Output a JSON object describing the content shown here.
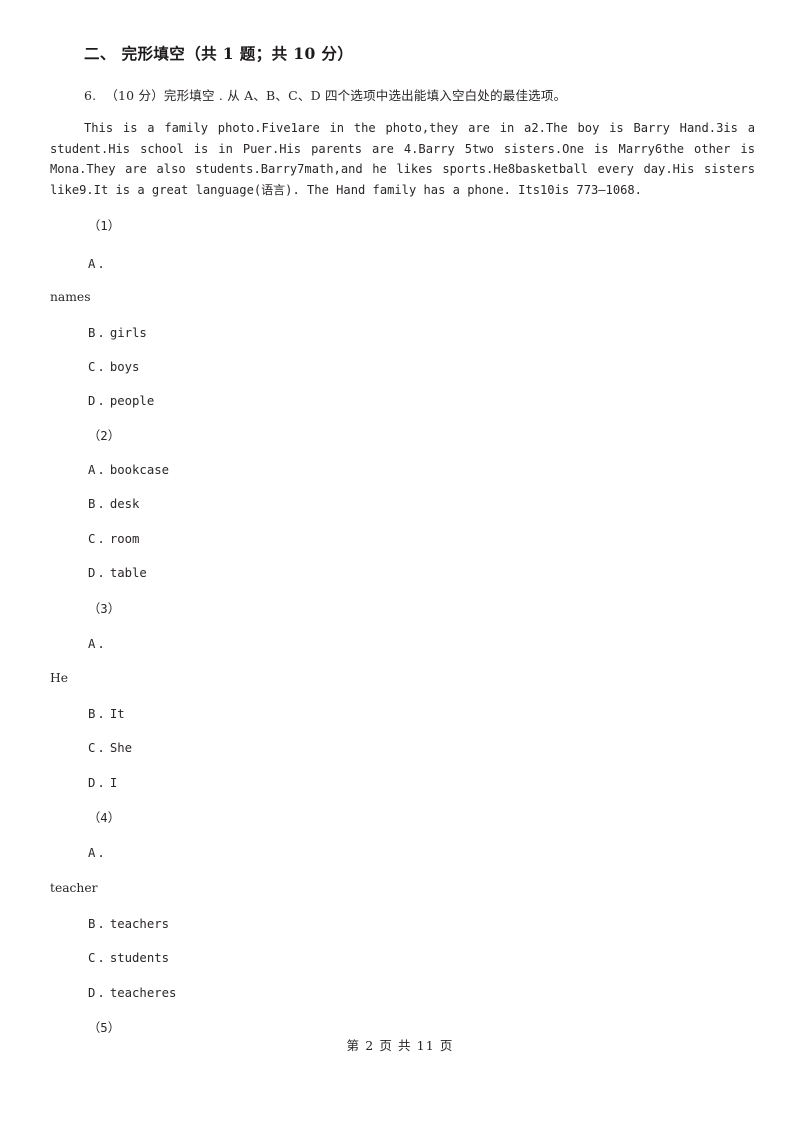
{
  "section": {
    "title": "二、 完形填空（共 1 题；共 10 分）"
  },
  "question": {
    "number": "6.",
    "stem": "（10 分）完形填空 . 从 A、B、C、D 四个选项中选出能填入空白处的最佳选项。",
    "passage": "This is a family photo.Five1are in the photo,they are in a2.The boy is Barry Hand.3is a student.His school is in Puer.His parents are 4.Barry 5two sisters.One is Marry6the other is Mona.They are also students.Barry7math,and he likes sports.He8basketball every day.His sisters like9.It is a great language(",
    "passage_cn": "语言",
    "passage_tail": "). The Hand family has a phone. Its10is 773—1068."
  },
  "options": [
    {
      "index": "（1）",
      "choices": [
        {
          "letter": "A",
          "text": "",
          "orphan_text": "names"
        },
        {
          "letter": "B",
          "text": "girls"
        },
        {
          "letter": "C",
          "text": "boys"
        },
        {
          "letter": "D",
          "text": "people"
        }
      ]
    },
    {
      "index": "（2）",
      "choices": [
        {
          "letter": "A",
          "text": "bookcase"
        },
        {
          "letter": "B",
          "text": "desk"
        },
        {
          "letter": "C",
          "text": "room"
        },
        {
          "letter": "D",
          "text": "table"
        }
      ]
    },
    {
      "index": "（3）",
      "choices": [
        {
          "letter": "A",
          "text": "",
          "orphan_text": "He"
        },
        {
          "letter": "B",
          "text": "It"
        },
        {
          "letter": "C",
          "text": "She"
        },
        {
          "letter": "D",
          "text": "I"
        }
      ]
    },
    {
      "index": "（4）",
      "choices": [
        {
          "letter": "A",
          "text": "",
          "orphan_text": "teacher"
        },
        {
          "letter": "B",
          "text": "teachers"
        },
        {
          "letter": "C",
          "text": "students"
        },
        {
          "letter": "D",
          "text": "teacheres"
        }
      ]
    },
    {
      "index": "（5）",
      "choices": []
    }
  ],
  "footer": {
    "text": "第 2 页 共 11 页"
  }
}
